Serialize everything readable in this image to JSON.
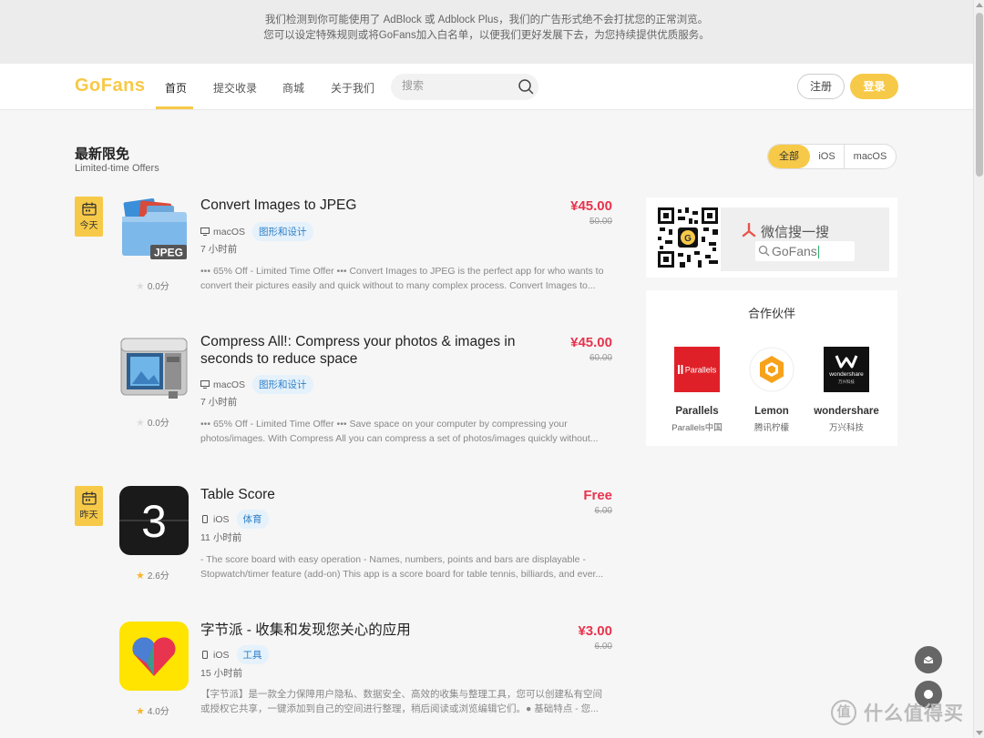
{
  "adblock_notice": {
    "line1": "我们检测到你可能使用了 AdBlock 或 Adblock Plus，我们的广告形式绝不会打扰您的正常浏览。",
    "line2": "您可以设定特殊规则或将GoFans加入白名单，以便我们更好发展下去，为您持续提供优质服务。"
  },
  "header": {
    "logo": "GoFans",
    "nav": [
      "首页",
      "提交收录",
      "商城",
      "关于我们"
    ],
    "active_nav": "首页",
    "search_placeholder": "搜索",
    "register": "注册",
    "login": "登录"
  },
  "section": {
    "title": "最新限免",
    "subtitle": "Limited-time Offers",
    "filters": [
      "全部",
      "iOS",
      "macOS"
    ],
    "active_filter": "全部"
  },
  "items": [
    {
      "day_badge": "今天",
      "title": "Convert Images to JPEG",
      "platform": "macOS",
      "category": "图形和设计",
      "time": "7 小时前",
      "rating": "0.0分",
      "description": "••• 65% Off - Limited Time Offer ••• Convert Images to JPEG is the perfect app for who wants to convert their pictures easily and quick without to many complex process. Convert Images to...",
      "price_now": "¥45.00",
      "price_old": "50.00",
      "icon": "folder-jpeg-icon"
    },
    {
      "day_badge": "",
      "title": "Compress All!: Compress your photos & images in seconds to reduce space",
      "platform": "macOS",
      "category": "图形和设计",
      "time": "7 小时前",
      "rating": "0.0分",
      "description": "••• 65% Off - Limited Time Offer ••• Save space on your computer by compressing your photos/images. With Compress All you can compress a set of photos/images quickly without...",
      "price_now": "¥45.00",
      "price_old": "60.00",
      "icon": "compress-vise-icon"
    },
    {
      "day_badge": "昨天",
      "title": "Table Score",
      "platform": "iOS",
      "category": "体育",
      "time": "11 小时前",
      "rating": "2.6分",
      "description": "- The score board with easy operation - Names, numbers, points and bars are displayable - Stopwatch/timer feature (add-on) This app is a score board for table tennis, billiards, and ever...",
      "price_now": "Free",
      "price_old": "6.00",
      "icon_text": "3"
    },
    {
      "day_badge": "",
      "title": "字节派 - 收集和发现您关心的应用",
      "platform": "iOS",
      "category": "工具",
      "time": "15 小时前",
      "rating": "4.0分",
      "description": "【字节派】是一款全力保障用户隐私、数据安全、高效的收集与整理工具，您可以创建私有空间或授权它共享，一键添加到自己的空间进行整理，稍后阅读或浏览编辑它们。● 基础特点 - 您...",
      "price_now": "¥3.00",
      "price_old": "6.00",
      "icon": "heart-icon"
    }
  ],
  "wechat": {
    "title": "微信搜一搜",
    "search_text": "GoFans"
  },
  "partners": {
    "title": "合作伙伴",
    "list": [
      {
        "name": "Parallels",
        "cn": "Parallels中国",
        "logo_text": "Parallels"
      },
      {
        "name": "Lemon",
        "cn": "腾讯柠檬",
        "logo_text": ""
      },
      {
        "name": "wondershare",
        "cn": "万兴科技",
        "logo_text": "wondershare",
        "logo_sub": "万兴科技"
      }
    ]
  },
  "watermark": {
    "badge": "值",
    "text": "什么值得买"
  },
  "colors": {
    "accent": "#f7c948",
    "price": "#e8344e",
    "tag_bg": "#e5f1fb",
    "tag_text": "#2d7fc6"
  }
}
